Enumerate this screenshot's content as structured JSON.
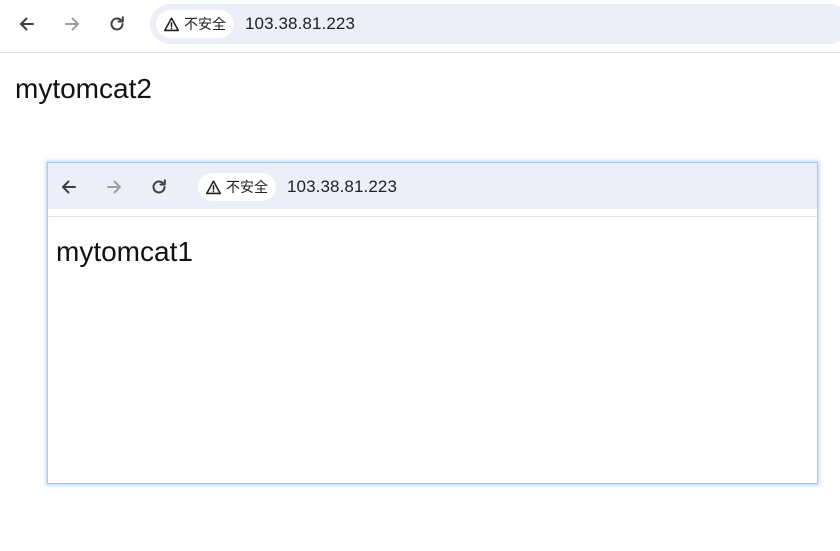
{
  "outer": {
    "toolbar": {
      "back_icon": "arrow-left-icon",
      "forward_icon": "arrow-right-icon",
      "reload_icon": "reload-icon",
      "security_icon": "warning-triangle-icon",
      "security_label": "不安全",
      "url": "103.38.81.223"
    },
    "page": {
      "heading": "mytomcat2"
    }
  },
  "inner": {
    "toolbar": {
      "back_icon": "arrow-left-icon",
      "forward_icon": "arrow-right-icon",
      "reload_icon": "reload-icon",
      "security_icon": "warning-triangle-icon",
      "security_label": "不安全",
      "url": "103.38.81.223"
    },
    "page": {
      "heading": "mytomcat1"
    }
  },
  "colors": {
    "omnibox_bg": "#eceff7",
    "window_border": "#a8c7f7",
    "icon_active": "#3c4043",
    "icon_disabled": "#9aa0a6"
  }
}
